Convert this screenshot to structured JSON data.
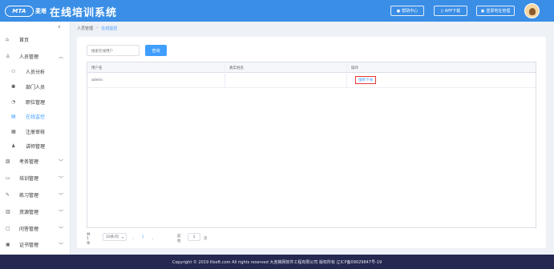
{
  "header": {
    "logo_text": "MTA",
    "logo_cn": "麦塔",
    "app_title": "在线培训系统",
    "help_label": "帮助中心",
    "app_download_label": "APP下载",
    "login_addr_label": "登录地址管理",
    "help_icon": "help-circle-icon",
    "app_icon": "mobile-icon",
    "login_icon": "link-icon",
    "brand_color": "#3a8ee6"
  },
  "sidebar": {
    "items": [
      {
        "label": "首页",
        "icon": "home-icon"
      },
      {
        "label": "人员管理",
        "icon": "user-icon",
        "expanded": true
      },
      {
        "label": "人员分析",
        "icon": "org-icon"
      },
      {
        "label": "部门人员",
        "icon": "users-icon"
      },
      {
        "label": "职位管理",
        "icon": "position-icon"
      },
      {
        "label": "在线监控",
        "icon": "monitor-icon",
        "active": true
      },
      {
        "label": "注册审核",
        "icon": "audit-icon"
      },
      {
        "label": "讲师管理",
        "icon": "teacher-icon"
      },
      {
        "label": "考务管理",
        "icon": "exam-icon"
      },
      {
        "label": "培训管理",
        "icon": "training-icon"
      },
      {
        "label": "练习管理",
        "icon": "practice-icon"
      },
      {
        "label": "资源管理",
        "icon": "resource-icon"
      },
      {
        "label": "问答管理",
        "icon": "qa-icon"
      },
      {
        "label": "证书管理",
        "icon": "certificate-icon"
      }
    ]
  },
  "breadcrumb": {
    "parent": "人员管理",
    "separator": ">",
    "current": "在线监控"
  },
  "search": {
    "placeholder": "搜索在线用户",
    "button_label": "查询"
  },
  "table": {
    "columns": [
      "用户名",
      "真实姓名",
      "操作"
    ],
    "rows": [
      {
        "username": "admin",
        "realname": "",
        "action": "强制下线"
      }
    ]
  },
  "pagination": {
    "total": "共 1 条",
    "page_size": "10条/页",
    "current_page": "1",
    "goto_label": "前往",
    "goto_value": "1",
    "page_suffix": "页"
  },
  "footer": {
    "copyright": "Copyright © 2019 lllsoft.com All rights reserved 大连格网软件工程有限公司 版权所有 辽ICP备09029847号-19"
  },
  "colors": {
    "accent": "#409eff",
    "danger_outline": "#e53935",
    "footer_bg": "#252850"
  }
}
